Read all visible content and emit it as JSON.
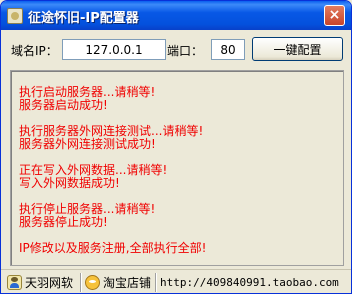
{
  "window": {
    "title": "征途怀旧-IP配置器",
    "close_symbol": "×"
  },
  "config": {
    "ip_label": "域名IP：",
    "ip_value": "127.0.0.1",
    "port_label": "端口：",
    "port_value": "80",
    "apply_button": "一键配置"
  },
  "log": {
    "lines": [
      "执行启动服务器...请稍等!",
      "服务器启动成功!",
      "",
      "执行服务器外网连接测试...请稍等!",
      "服务器外网连接测试成功!",
      "",
      "正在写入外网数据...请稍等!",
      "写入外网数据成功!",
      "",
      "执行停止服务器...请稍等!",
      "服务器停止成功!",
      "",
      "IP修改以及服务注册,全部执行全部!"
    ]
  },
  "statusbar": {
    "author": "天羽网软",
    "shop": "淘宝店铺",
    "url": "http://409840991.taobao.com"
  },
  "colors": {
    "log_text": "#f00000",
    "title_bar": "#0858e6"
  }
}
